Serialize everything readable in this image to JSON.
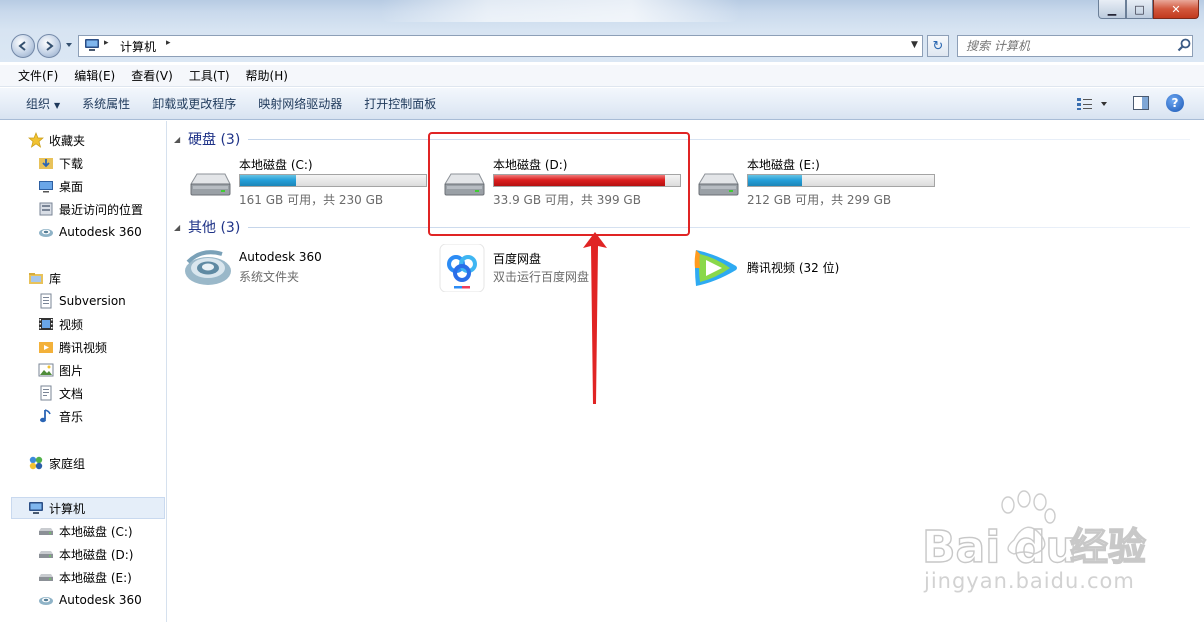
{
  "window": {
    "minimize": "▁",
    "maximize": "□",
    "close": "✕"
  },
  "address": {
    "crumb": "计算机",
    "separator": "▸",
    "dropdown": "▼",
    "refresh": "↻"
  },
  "search": {
    "placeholder": "搜索 计算机"
  },
  "menu": [
    {
      "label": "文件(F)"
    },
    {
      "label": "编辑(E)"
    },
    {
      "label": "查看(V)"
    },
    {
      "label": "工具(T)"
    },
    {
      "label": "帮助(H)"
    }
  ],
  "commands": {
    "organize": "组织",
    "organize_arrow": "▼",
    "system_properties": "系统属性",
    "uninstall": "卸载或更改程序",
    "map_drive": "映射网络驱动器",
    "control_panel": "打开控制面板",
    "help": "?"
  },
  "nav": {
    "favorites": {
      "label": "收藏夹",
      "items": [
        "下载",
        "桌面",
        "最近访问的位置",
        "Autodesk 360"
      ]
    },
    "libraries": {
      "label": "库",
      "items": [
        "Subversion",
        "视频",
        "腾讯视频",
        "图片",
        "文档",
        "音乐"
      ]
    },
    "homegroup": {
      "label": "家庭组"
    },
    "computer": {
      "label": "计算机",
      "items": [
        "本地磁盘 (C:)",
        "本地磁盘 (D:)",
        "本地磁盘 (E:)",
        "Autodesk 360"
      ]
    }
  },
  "groups": {
    "drives": {
      "title": "硬盘 (3)",
      "collapse": "◢"
    },
    "others": {
      "title": "其他 (3)",
      "collapse": "◢"
    }
  },
  "drives": [
    {
      "name": "本地磁盘 (C:)",
      "info": "161 GB 可用，共 230 GB",
      "used_fraction": 0.3,
      "warning": false
    },
    {
      "name": "本地磁盘 (D:)",
      "info": "33.9 GB 可用，共 399 GB",
      "used_fraction": 0.92,
      "warning": true
    },
    {
      "name": "本地磁盘 (E:)",
      "info": "212 GB 可用，共 299 GB",
      "used_fraction": 0.29,
      "warning": false
    }
  ],
  "others": [
    {
      "name": "Autodesk 360",
      "sub": "系统文件夹"
    },
    {
      "name": "百度网盘",
      "sub": "双击运行百度网盘"
    },
    {
      "name": "腾讯视频 (32 位)",
      "sub": ""
    }
  ],
  "colors": {
    "usage_normal": "#26a0da",
    "usage_warning": "#dc1f1f",
    "annotation": "#e02424",
    "group_title": "#1e3287"
  },
  "watermark": {
    "brand": "Bai",
    "brand_end": "du",
    "brand_cn": "经验",
    "url": "jingyan.baidu.com"
  }
}
